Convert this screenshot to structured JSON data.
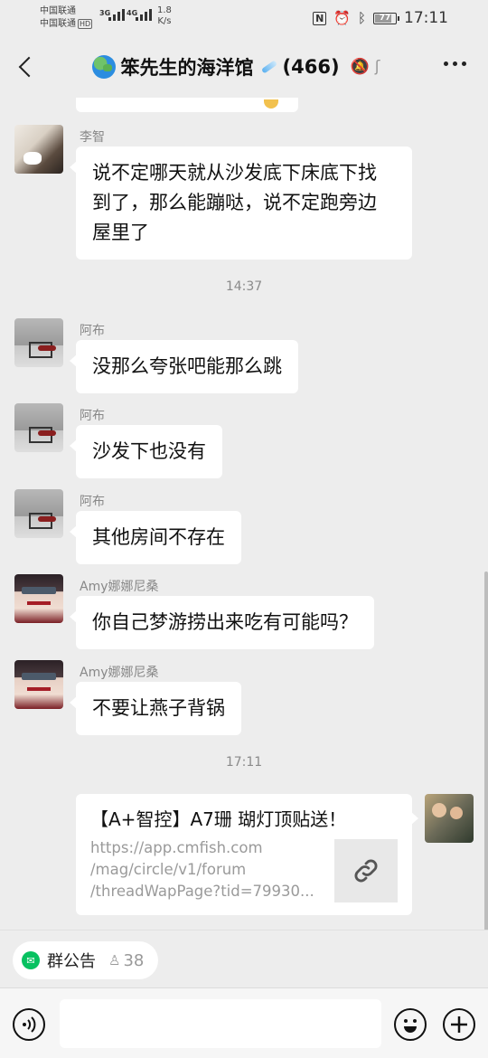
{
  "status_bar": {
    "carrier1": "中国联通",
    "carrier2": "中国联通",
    "hd": "HD",
    "net1": "3G",
    "net2": "4G",
    "speed_value": "1.8",
    "speed_unit": "K/s",
    "battery": "77",
    "battery_level": 0.77,
    "time": "17:11"
  },
  "header": {
    "title": "笨先生的海洋馆",
    "member_count": "(466)"
  },
  "messages": [
    {
      "sender": "李智",
      "lines": [
        "说不定哪天就从沙发底下床底下找",
        "到了，那么能蹦哒，说不定跑旁边",
        "屋里了"
      ]
    },
    {
      "time": "14:37"
    },
    {
      "sender": "阿布",
      "text": "没那么夸张吧能那么跳"
    },
    {
      "sender": "阿布",
      "text": "沙发下也没有"
    },
    {
      "sender": "阿布",
      "text": "其他房间不存在"
    },
    {
      "sender": "Amy娜娜尼桑",
      "text": "你自己梦游捞出来吃有可能吗？"
    },
    {
      "sender": "Amy娜娜尼桑",
      "text": "不要让燕子背锅"
    },
    {
      "time": "17:11"
    }
  ],
  "link_card": {
    "title": "【A+智控】A7珊 瑚灯顶贴送！",
    "url_lines": [
      "https://app.cmfish.com",
      "/mag/circle/v1/forum",
      "/threadWapPage?tid=79930..."
    ]
  },
  "notice": {
    "label": "群公告",
    "count": "38"
  },
  "input": {
    "value": ""
  }
}
